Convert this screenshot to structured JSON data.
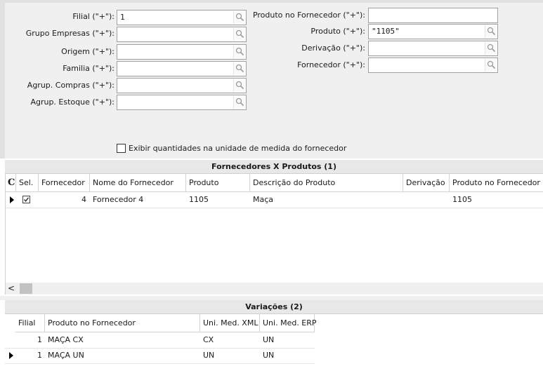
{
  "filters_left": [
    {
      "label": "Filial (\"+\"):",
      "value": "1"
    },
    {
      "label": "Grupo Empresas (\"+\"):",
      "value": ""
    },
    {
      "label": "Origem (\"+\"):",
      "value": ""
    },
    {
      "label": "Familia (\"+\"):",
      "value": ""
    },
    {
      "label": "Agrup. Compras (\"+\"):",
      "value": ""
    },
    {
      "label": "Agrup. Estoque (\"+\"):",
      "value": ""
    }
  ],
  "filters_right": [
    {
      "label": "Produto no Fornecedor (\"+\"):",
      "value": ""
    },
    {
      "label": "Produto (\"+\"):",
      "value": "\"1105\""
    },
    {
      "label": "Derivação (\"+\"):",
      "value": ""
    },
    {
      "label": "Fornecedor (\"+\"):",
      "value": ""
    }
  ],
  "checkbox_label": "Exibir quantidades na unidade de medida do fornecedor",
  "grid1": {
    "title": "Fornecedores X Produtos (1)",
    "columns": [
      "C",
      "Sel.",
      "Fornecedor",
      "Nome do Fornecedor",
      "Produto",
      "Descrição do Produto",
      "Derivação",
      "Produto no Fornecedor"
    ],
    "rows": [
      {
        "fornecedor": "4",
        "nome": "Fornecedor 4",
        "produto": "1105",
        "descricao": "Maça",
        "derivacao": "",
        "produto_fornecedor": "1105"
      }
    ],
    "scroll_left": "<"
  },
  "grid2": {
    "title": "Variações (2)",
    "columns": [
      "Filial",
      "Produto no Fornecedor",
      "Uni. Med. XML",
      "Uni. Med. ERP"
    ],
    "rows": [
      {
        "filial": "1",
        "produto_fornecedor": "MAÇA CX",
        "xml": "CX",
        "erp": "UN"
      },
      {
        "filial": "1",
        "produto_fornecedor": "MAÇA UN",
        "xml": "UN",
        "erp": "UN"
      }
    ]
  }
}
